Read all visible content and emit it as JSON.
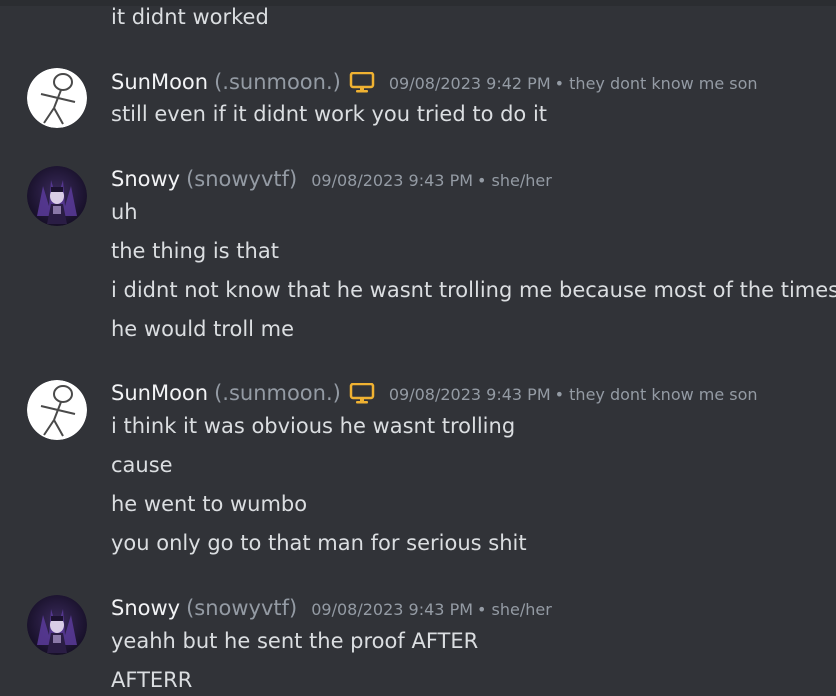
{
  "messages": {
    "top_line": "it didnt worked",
    "group1": {
      "author": "SunMoon",
      "username": "(.sunmoon.)",
      "timestamp": "09/08/2023 9:42 PM",
      "pronouns": "• they dont know me son",
      "lines": [
        "still even if it didnt work you tried to do it"
      ]
    },
    "group2": {
      "author": "Snowy",
      "username": "(snowyvtf)",
      "timestamp": "09/08/2023 9:43 PM",
      "pronouns": "• she/her",
      "lines": [
        "uh",
        "the thing is that",
        "i didnt not know that he wasnt trolling me because most of the times",
        "he would troll me"
      ]
    },
    "group3": {
      "author": "SunMoon",
      "username": "(.sunmoon.)",
      "timestamp": "09/08/2023 9:43 PM",
      "pronouns": "• they dont know me son",
      "lines": [
        "i think it was obvious he wasnt trolling",
        "cause",
        "he went to wumbo",
        "you only go to that man for serious shit"
      ]
    },
    "group4": {
      "author": "Snowy",
      "username": "(snowyvtf)",
      "timestamp": "09/08/2023 9:43 PM",
      "pronouns": "• she/her",
      "lines": [
        "yeahh but he sent the proof AFTER",
        "AFTERR"
      ]
    }
  },
  "icons": {
    "device": "desktop-icon",
    "avatar_sunmoon": "stick-figure-avatar",
    "avatar_snowy": "dark-character-avatar"
  },
  "colors": {
    "background": "#313338",
    "text": "#dbdee1",
    "author": "#f2f3f5",
    "muted": "#949ba4",
    "device_icon": "#f0b232"
  }
}
